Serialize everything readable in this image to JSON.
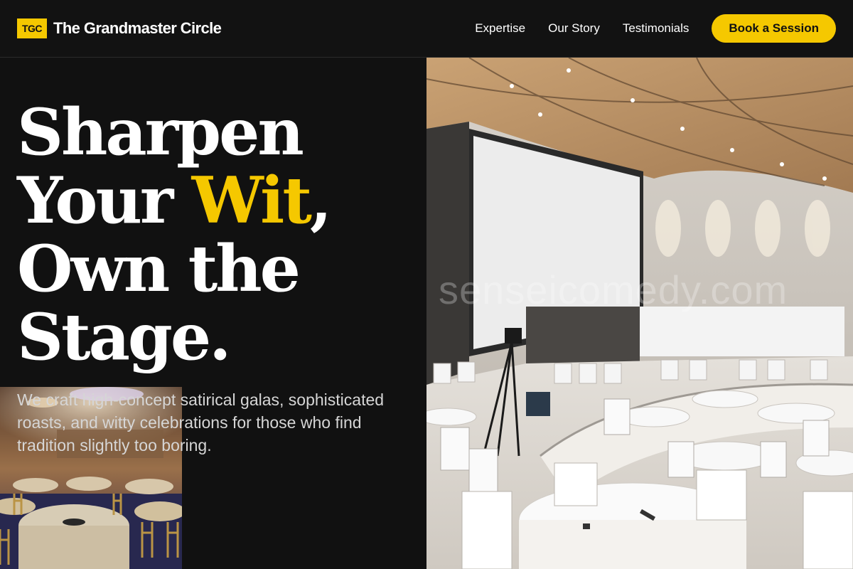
{
  "header": {
    "logo_badge": "TGC",
    "brand_name": "The Grandmaster Circle",
    "nav": [
      {
        "label": "Expertise"
      },
      {
        "label": "Our Story"
      },
      {
        "label": "Testimonials"
      }
    ],
    "cta_label": "Book a Session"
  },
  "hero": {
    "title_line1": "Sharpen",
    "title_line2_pre": "Your ",
    "title_line2_accent": "Wit",
    "title_line2_post": ",",
    "title_line3": "Own the",
    "title_line4": "Stage.",
    "subtitle": "We craft high-concept satirical galas, sophisticated roasts, and witty celebrations for those who find tradition slightly too boring."
  },
  "watermark": "senseicomedy.com",
  "colors": {
    "accent": "#f5c800",
    "background": "#111111",
    "text": "#ffffff"
  }
}
